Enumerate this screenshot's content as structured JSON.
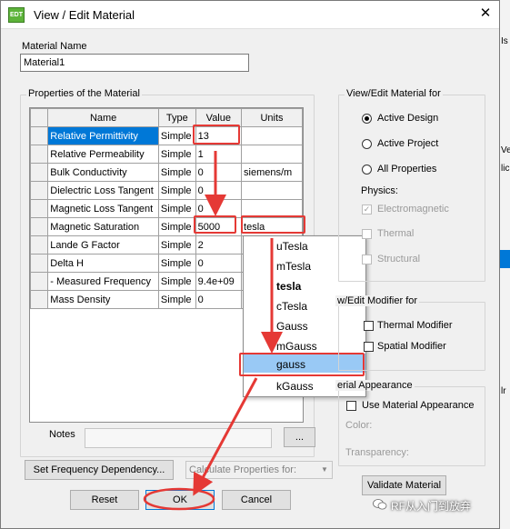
{
  "window": {
    "title": "View / Edit Material",
    "icon_text": "EDT",
    "close_glyph": "✕"
  },
  "material_name": {
    "label": "Material Name",
    "value": "Material1"
  },
  "properties_group": {
    "title": "Properties of the Material"
  },
  "table": {
    "headers": [
      "Name",
      "Type",
      "Value",
      "Units"
    ],
    "rows": [
      {
        "name": "Relative Permittivity",
        "type": "Simple",
        "value": "13",
        "units": ""
      },
      {
        "name": "Relative Permeability",
        "type": "Simple",
        "value": "1",
        "units": ""
      },
      {
        "name": "Bulk Conductivity",
        "type": "Simple",
        "value": "0",
        "units": "siemens/m"
      },
      {
        "name": "Dielectric Loss Tangent",
        "type": "Simple",
        "value": "0",
        "units": ""
      },
      {
        "name": "Magnetic Loss Tangent",
        "type": "Simple",
        "value": "0",
        "units": ""
      },
      {
        "name": "Magnetic Saturation",
        "type": "Simple",
        "value": "5000",
        "units": "tesla"
      },
      {
        "name": "Lande G Factor",
        "type": "Simple",
        "value": "2",
        "units": ""
      },
      {
        "name": "Delta H",
        "type": "Simple",
        "value": "0",
        "units": ""
      },
      {
        "name": "-  Measured Frequency",
        "type": "Simple",
        "value": "9.4e+09",
        "units": ""
      },
      {
        "name": "Mass Density",
        "type": "Simple",
        "value": "0",
        "units": ""
      }
    ],
    "selected_row": 0
  },
  "units_dropdown": {
    "items": [
      "uTesla",
      "mTesla",
      "tesla",
      "cTesla",
      "Gauss",
      "mGauss",
      "gauss",
      "kGauss"
    ],
    "highlighted": "gauss"
  },
  "notes": {
    "label": "Notes",
    "value": "",
    "browse_label": "..."
  },
  "buttons": {
    "set_freq": "Set Frequency Dependency...",
    "calc_props": "Calculate Properties for:",
    "reset": "Reset",
    "ok": "OK",
    "cancel": "Cancel",
    "validate": "Validate Material"
  },
  "view_edit_for": {
    "title": "View/Edit Material for",
    "options": [
      "Active Design",
      "Active Project",
      "All Properties"
    ],
    "selected": "Active Design",
    "physics_label": "Physics:",
    "physics": [
      "Electromagnetic",
      "Thermal",
      "Structural"
    ]
  },
  "modifier_group": {
    "title": "w/Edit Modifier for",
    "thermal": "Thermal Modifier",
    "spatial": "Spatial Modifier"
  },
  "appearance_group": {
    "title": "erial Appearance",
    "use_label": "Use Material Appearance",
    "color_label": "Color:",
    "transparency_label": "Transparency:"
  },
  "background_app": {
    "text_1": "Is",
    "text_2": "Ve",
    "text_3": "lic",
    "text_4": "lr"
  },
  "watermark": {
    "text": "RF从入门到放弃"
  },
  "colors": {
    "accent": "#0078d7",
    "annotation": "#e53935",
    "highlight": "#99c9f5"
  }
}
